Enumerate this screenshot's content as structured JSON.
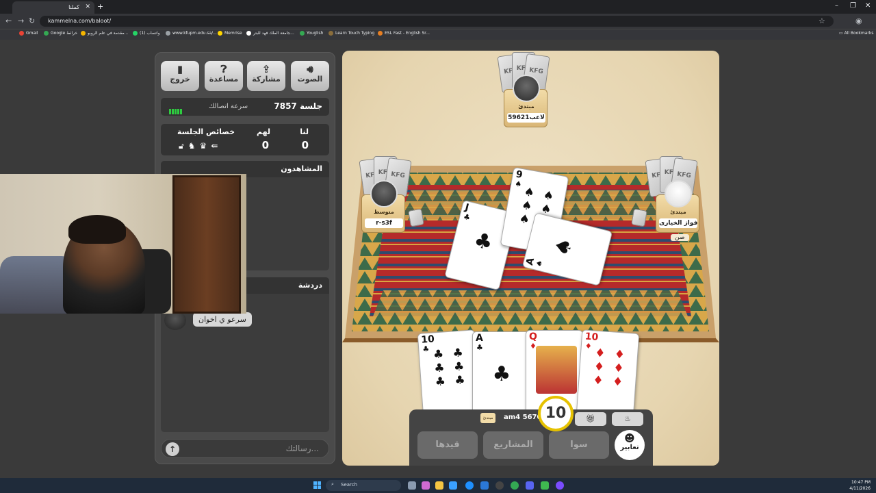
{
  "browser": {
    "tab_title": "كملنا",
    "url": "kammelna.com/baloot/",
    "bookmarks": [
      "Gmail",
      "Google خرائط",
      "مقدمة في علم الروبو...",
      "(1) واتساب",
      "www.kfupm.edu.sa/...",
      "Memrise",
      "جامعة الملك فهد للبتر...",
      "Youglish",
      "Learn Touch Typing",
      "ESL Fast - English Sr..."
    ],
    "all_bookmarks": "All Bookmarks"
  },
  "panel": {
    "buttons": [
      {
        "label": "الصوت",
        "icon": "speaker-icon"
      },
      {
        "label": "مشاركة",
        "icon": "share-icon"
      },
      {
        "label": "مساعدة",
        "icon": "help-icon"
      },
      {
        "label": "خروج",
        "icon": "exit-icon"
      }
    ],
    "session_label": "جلسة 7857",
    "connection_label": "سرعة اتصالك",
    "score": {
      "us_label": "لنا",
      "them_label": "لهم",
      "props_label": "خصائص الجلسة",
      "us": "0",
      "them": "0"
    },
    "viewers_label": "المشاهدون",
    "chat_label": "دردشة",
    "chat_message": "سرعو ي اخوان",
    "message_placeholder": "رسالتك..."
  },
  "game": {
    "top_player": {
      "level": "مبتدئ",
      "name": "لاعب59621"
    },
    "left_player": {
      "level": "متوسط",
      "name": "r-s3f"
    },
    "right_player": {
      "level": "مبتدئ",
      "name": "فواز الخيارى",
      "role": "صن"
    },
    "me": {
      "level": "مبتدئ",
      "name": "am4 5670"
    },
    "timer": "10",
    "table_cards": [
      {
        "rank": "9",
        "suit": "♠",
        "color": "black"
      },
      {
        "rank": "J",
        "suit": "♣",
        "color": "black"
      },
      {
        "rank": "A",
        "suit": "♠",
        "color": "black"
      }
    ],
    "hand_cards": [
      {
        "rank": "10",
        "suit": "♣",
        "color": "black"
      },
      {
        "rank": "A",
        "suit": "♣",
        "color": "black"
      },
      {
        "rank": "Q",
        "suit": "♦",
        "color": "red"
      },
      {
        "rank": "10",
        "suit": "♦",
        "color": "red"
      }
    ],
    "actions": {
      "qaydha": "قيدها",
      "projects": "المشاريع",
      "sawa": "سوا",
      "expressions": "تعابير"
    }
  },
  "taskbar": {
    "search": "Search",
    "time": "10:47 PM",
    "date": "4/11/2026"
  }
}
